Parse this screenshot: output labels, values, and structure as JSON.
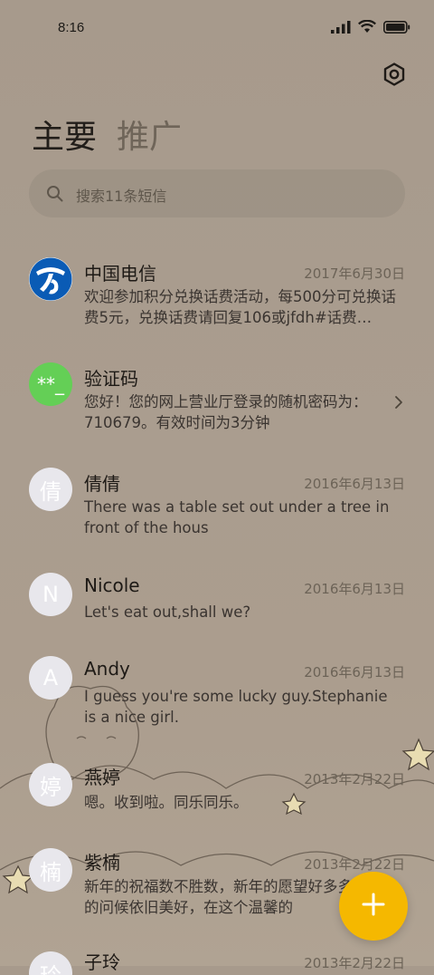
{
  "status": {
    "time": "8:16"
  },
  "tabs": [
    {
      "label": "主要"
    },
    {
      "label": "推广"
    }
  ],
  "search": {
    "placeholder": "搜索11条短信"
  },
  "conversations": [
    {
      "name": "中国电信",
      "date": "2017年6月30日",
      "preview": "欢迎参加积分兑换话费活动，每500分可兑换话费5元，兑换话费请回复106或jfdh#话费…",
      "avatar_text": "",
      "avatar": "china-telecom-logo"
    },
    {
      "name": "验证码",
      "date": "",
      "preview": "您好！您的网上营业厅登录的随机密码为：710679。有效时间为3分钟",
      "avatar_text": "**_",
      "avatar_color": "#64cf56"
    },
    {
      "name": "倩倩",
      "date": "2016年6月13日",
      "preview": "There was a table set out under a tree in front of the hous",
      "avatar_text": "倩"
    },
    {
      "name": "Nicole",
      "date": "2016年6月13日",
      "preview": "Let's eat out,shall we?",
      "avatar_text": "N"
    },
    {
      "name": "Andy",
      "date": "2016年6月13日",
      "preview": "I guess you're some lucky guy.Stephanie is a nice girl.",
      "avatar_text": "A"
    },
    {
      "name": "燕婷",
      "date": "2013年2月22日",
      "preview": "嗯。收到啦。同乐同乐。",
      "avatar_text": "婷"
    },
    {
      "name": "紫楠",
      "date": "2013年2月22日",
      "preview": "新年的祝福数不胜数，新年的愿望好多多，新年的问候依旧美好，在这个温馨的",
      "avatar_text": "楠"
    },
    {
      "name": "子玲",
      "date": "2013年2月22日",
      "preview": "",
      "avatar_text": "玲"
    }
  ],
  "fab": {
    "icon": "plus-icon",
    "color": "#f5b800"
  },
  "colors": {
    "accent": "#f5b800",
    "verification_avatar": "#64cf56",
    "telecom_blue": "#0a5bb5"
  }
}
